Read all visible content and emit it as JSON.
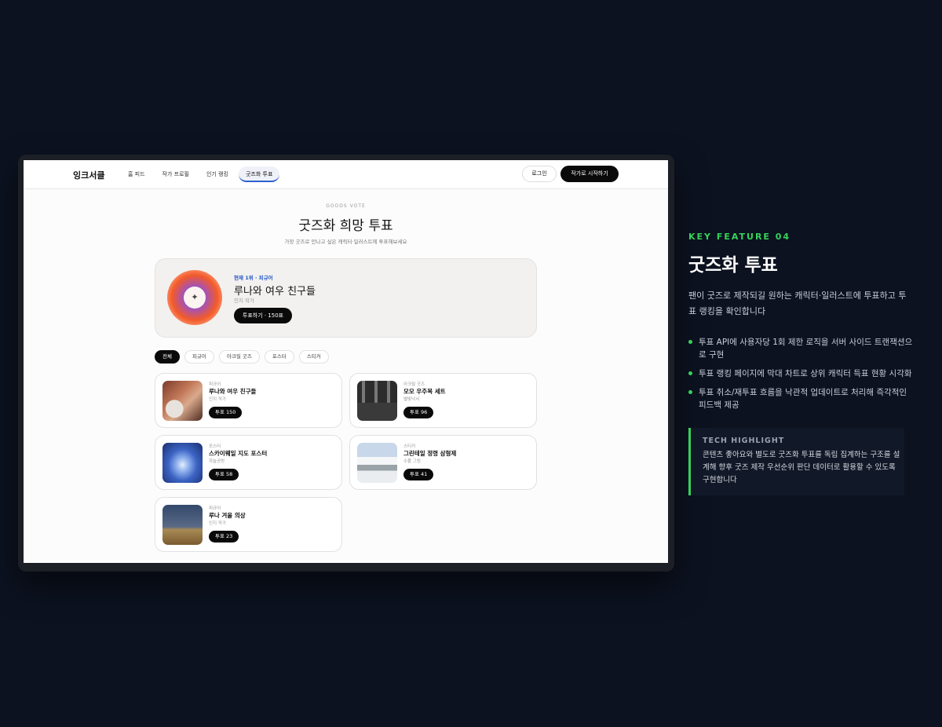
{
  "nav": {
    "logo": "잉크서클",
    "links": [
      "홈 피드",
      "작가 프로필",
      "인기 랭킹",
      "굿즈화 투표"
    ],
    "login": "로그인",
    "start": "작가로 시작하기"
  },
  "header": {
    "eyebrow": "GOODS VOTE",
    "title": "굿즈화 희망 투표",
    "subtitle": "가장 굿즈로 만나고 싶은 캐릭터·일러스트에 투표해보세요"
  },
  "hero": {
    "icon": "sparkle-icon",
    "rank": "현재 1위 · 피규어",
    "name": "루나와 여우 친구들",
    "artist": "인지 작가",
    "vote": "투표하기 · 150표"
  },
  "filters": [
    "전체",
    "피규어",
    "아크릴 굿즈",
    "포스터",
    "스티커"
  ],
  "items": [
    {
      "category": "피규어",
      "name": "루나와 여우 친구들",
      "artist": "인지 작가",
      "vote": "투표 150"
    },
    {
      "category": "아크릴 굿즈",
      "name": "모모 우주복 세트",
      "artist": "별빛낙서",
      "vote": "투표 96"
    },
    {
      "category": "포스터",
      "name": "스카이웨일 지도 포스터",
      "artist": "하늘공방",
      "vote": "투표 58"
    },
    {
      "category": "스티커",
      "name": "그린테일 정령 삼형제",
      "artist": "수풀 그림",
      "vote": "투표 41"
    },
    {
      "category": "피규어",
      "name": "루나 겨울 의상",
      "artist": "인지 작가",
      "vote": "투표 23"
    }
  ],
  "feature": {
    "label": "KEY FEATURE 04",
    "title": "굿즈화 투표",
    "description": "팬이 굿즈로 제작되길 원하는 캐릭터·일러스트에 투표하고 투표 랭킹을 확인합니다",
    "bullets": [
      "투표 API에 사용자당 1회 제한 로직을 서버 사이드 트랜잭션으로 구현",
      "투표 랭킹 페이지에 막대 차트로 상위 캐릭터 득표 현황 시각화",
      "투표 취소/재투표 흐름을 낙관적 업데이트로 처리해 즉각적인 피드백 제공"
    ],
    "tech_label": "TECH HIGHLIGHT",
    "tech_text": "콘텐츠 좋아요와 별도로 굿즈화 투표를 독립 집계하는 구조를 설계해 향후 굿즈 제작 우선순위 판단 데이터로 활용할 수 있도록 구현합니다"
  },
  "colors": {
    "accent": "#35d35a",
    "background": "#0c1220",
    "rank_blue": "#2557c9"
  }
}
